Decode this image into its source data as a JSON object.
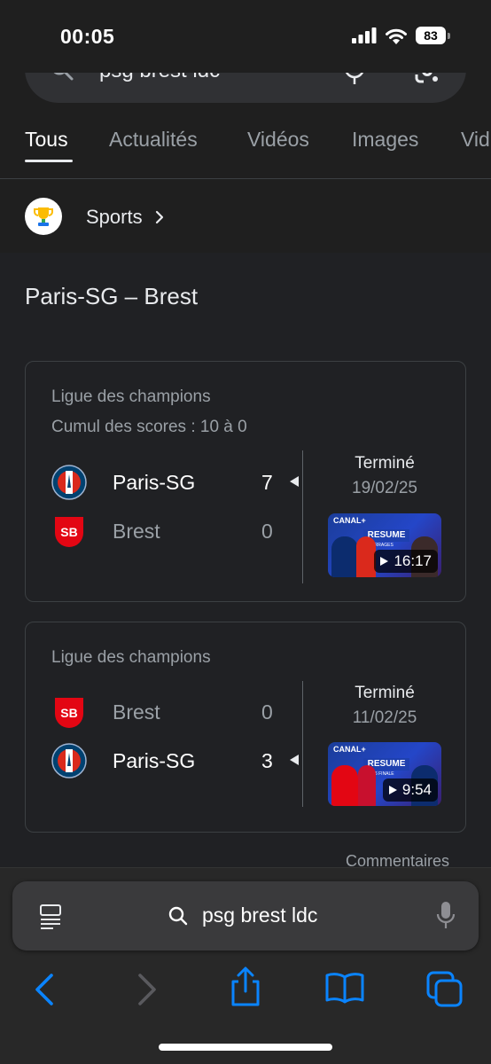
{
  "status_bar": {
    "time": "00:05",
    "battery": "83"
  },
  "search": {
    "query": "psg brest ldc"
  },
  "tabs": [
    {
      "label": "Tous",
      "active": true
    },
    {
      "label": "Actualités",
      "active": false
    },
    {
      "label": "Vidéos",
      "active": false
    },
    {
      "label": "Images",
      "active": false
    },
    {
      "label": "Vid",
      "active": false
    }
  ],
  "sports": {
    "label": "Sports"
  },
  "match": {
    "heading": "Paris-SG – Brest",
    "cards": [
      {
        "league": "Ligue des champions",
        "cumul": "Cumul des scores : 10 à 0",
        "teams": [
          {
            "name": "Paris-SG",
            "score": "7",
            "winner": true
          },
          {
            "name": "Brest",
            "score": "0",
            "winner": false
          }
        ],
        "status": "Terminé",
        "date": "19/02/25",
        "video": {
          "channel": "CANAL+",
          "title": "RESUME",
          "subtitle": "BARRAGES",
          "duration": "16:17"
        }
      },
      {
        "league": "Ligue des champions",
        "teams": [
          {
            "name": "Brest",
            "score": "0",
            "winner": false
          },
          {
            "name": "Paris-SG",
            "score": "3",
            "winner": true
          }
        ],
        "status": "Terminé",
        "date": "11/02/25",
        "video": {
          "channel": "CANAL+",
          "title": "RESUME",
          "subtitle": "1/16 FINALE",
          "duration": "9:54"
        }
      }
    ]
  },
  "comments_label": "Commentaires",
  "address_bar": {
    "text": "psg brest ldc"
  },
  "colors": {
    "background": "#1f1f1f",
    "results_background": "#202124",
    "card_border": "#3c4043",
    "accent_blue": "#0a84ff",
    "psg_blue": "#004170",
    "psg_red": "#da291c",
    "brest_red": "#e30613"
  },
  "icons": {
    "search": "magnifier-icon",
    "mic": "microphone-icon",
    "lens": "google-lens-icon",
    "sports": "trophy-icon",
    "reader": "reader-mode-icon",
    "back": "back-arrow-icon",
    "forward": "forward-arrow-icon",
    "share": "share-icon",
    "bookmarks": "bookmarks-book-icon",
    "tabs": "tabs-overview-icon"
  }
}
